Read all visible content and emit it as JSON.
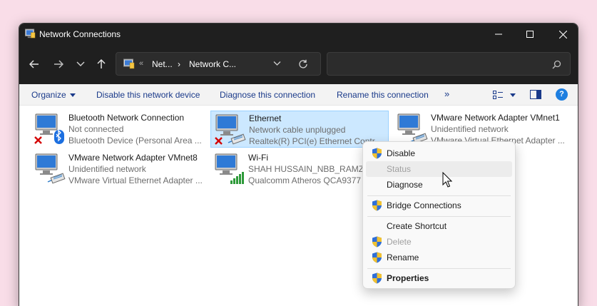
{
  "window": {
    "title": "Network Connections"
  },
  "address": {
    "back_icon": "arrow-left-icon",
    "crumb_overflow": "«",
    "crumb1": "Net...",
    "crumb_separator": "›",
    "crumb2": "Network C..."
  },
  "search": {
    "placeholder": ""
  },
  "commands": {
    "organize": "Organize",
    "disable": "Disable this network device",
    "diagnose": "Diagnose this connection",
    "rename": "Rename this connection",
    "more": "»",
    "help": "?"
  },
  "connections": [
    {
      "name": "Bluetooth Network Connection",
      "status": "Not connected",
      "device": "Bluetooth Device (Personal Area ...",
      "icon": "bluetooth-network-icon"
    },
    {
      "name": "Ethernet",
      "status": "Network cable unplugged",
      "device": "Realtek(R) PCI(e) Ethernet Control...",
      "icon": "ethernet-network-icon"
    },
    {
      "name": "VMware Network Adapter VMnet1",
      "status": "Unidentified network",
      "device": "VMware Virtual Ethernet Adapter ...",
      "icon": "vmware-network-icon"
    },
    {
      "name": "VMware Network Adapter VMnet8",
      "status": "Unidentified network",
      "device": "VMware Virtual Ethernet Adapter ...",
      "icon": "vmware-network-icon"
    },
    {
      "name": "Wi-Fi",
      "status": "SHAH HUSSAIN_NBB_RAMZAN",
      "device": "Qualcomm Atheros QCA9377 ...",
      "icon": "wifi-network-icon"
    }
  ],
  "context_menu": {
    "disable": "Disable",
    "status": "Status",
    "diagnose": "Diagnose",
    "bridge": "Bridge Connections",
    "shortcut": "Create Shortcut",
    "delete": "Delete",
    "rename": "Rename",
    "properties": "Properties"
  }
}
